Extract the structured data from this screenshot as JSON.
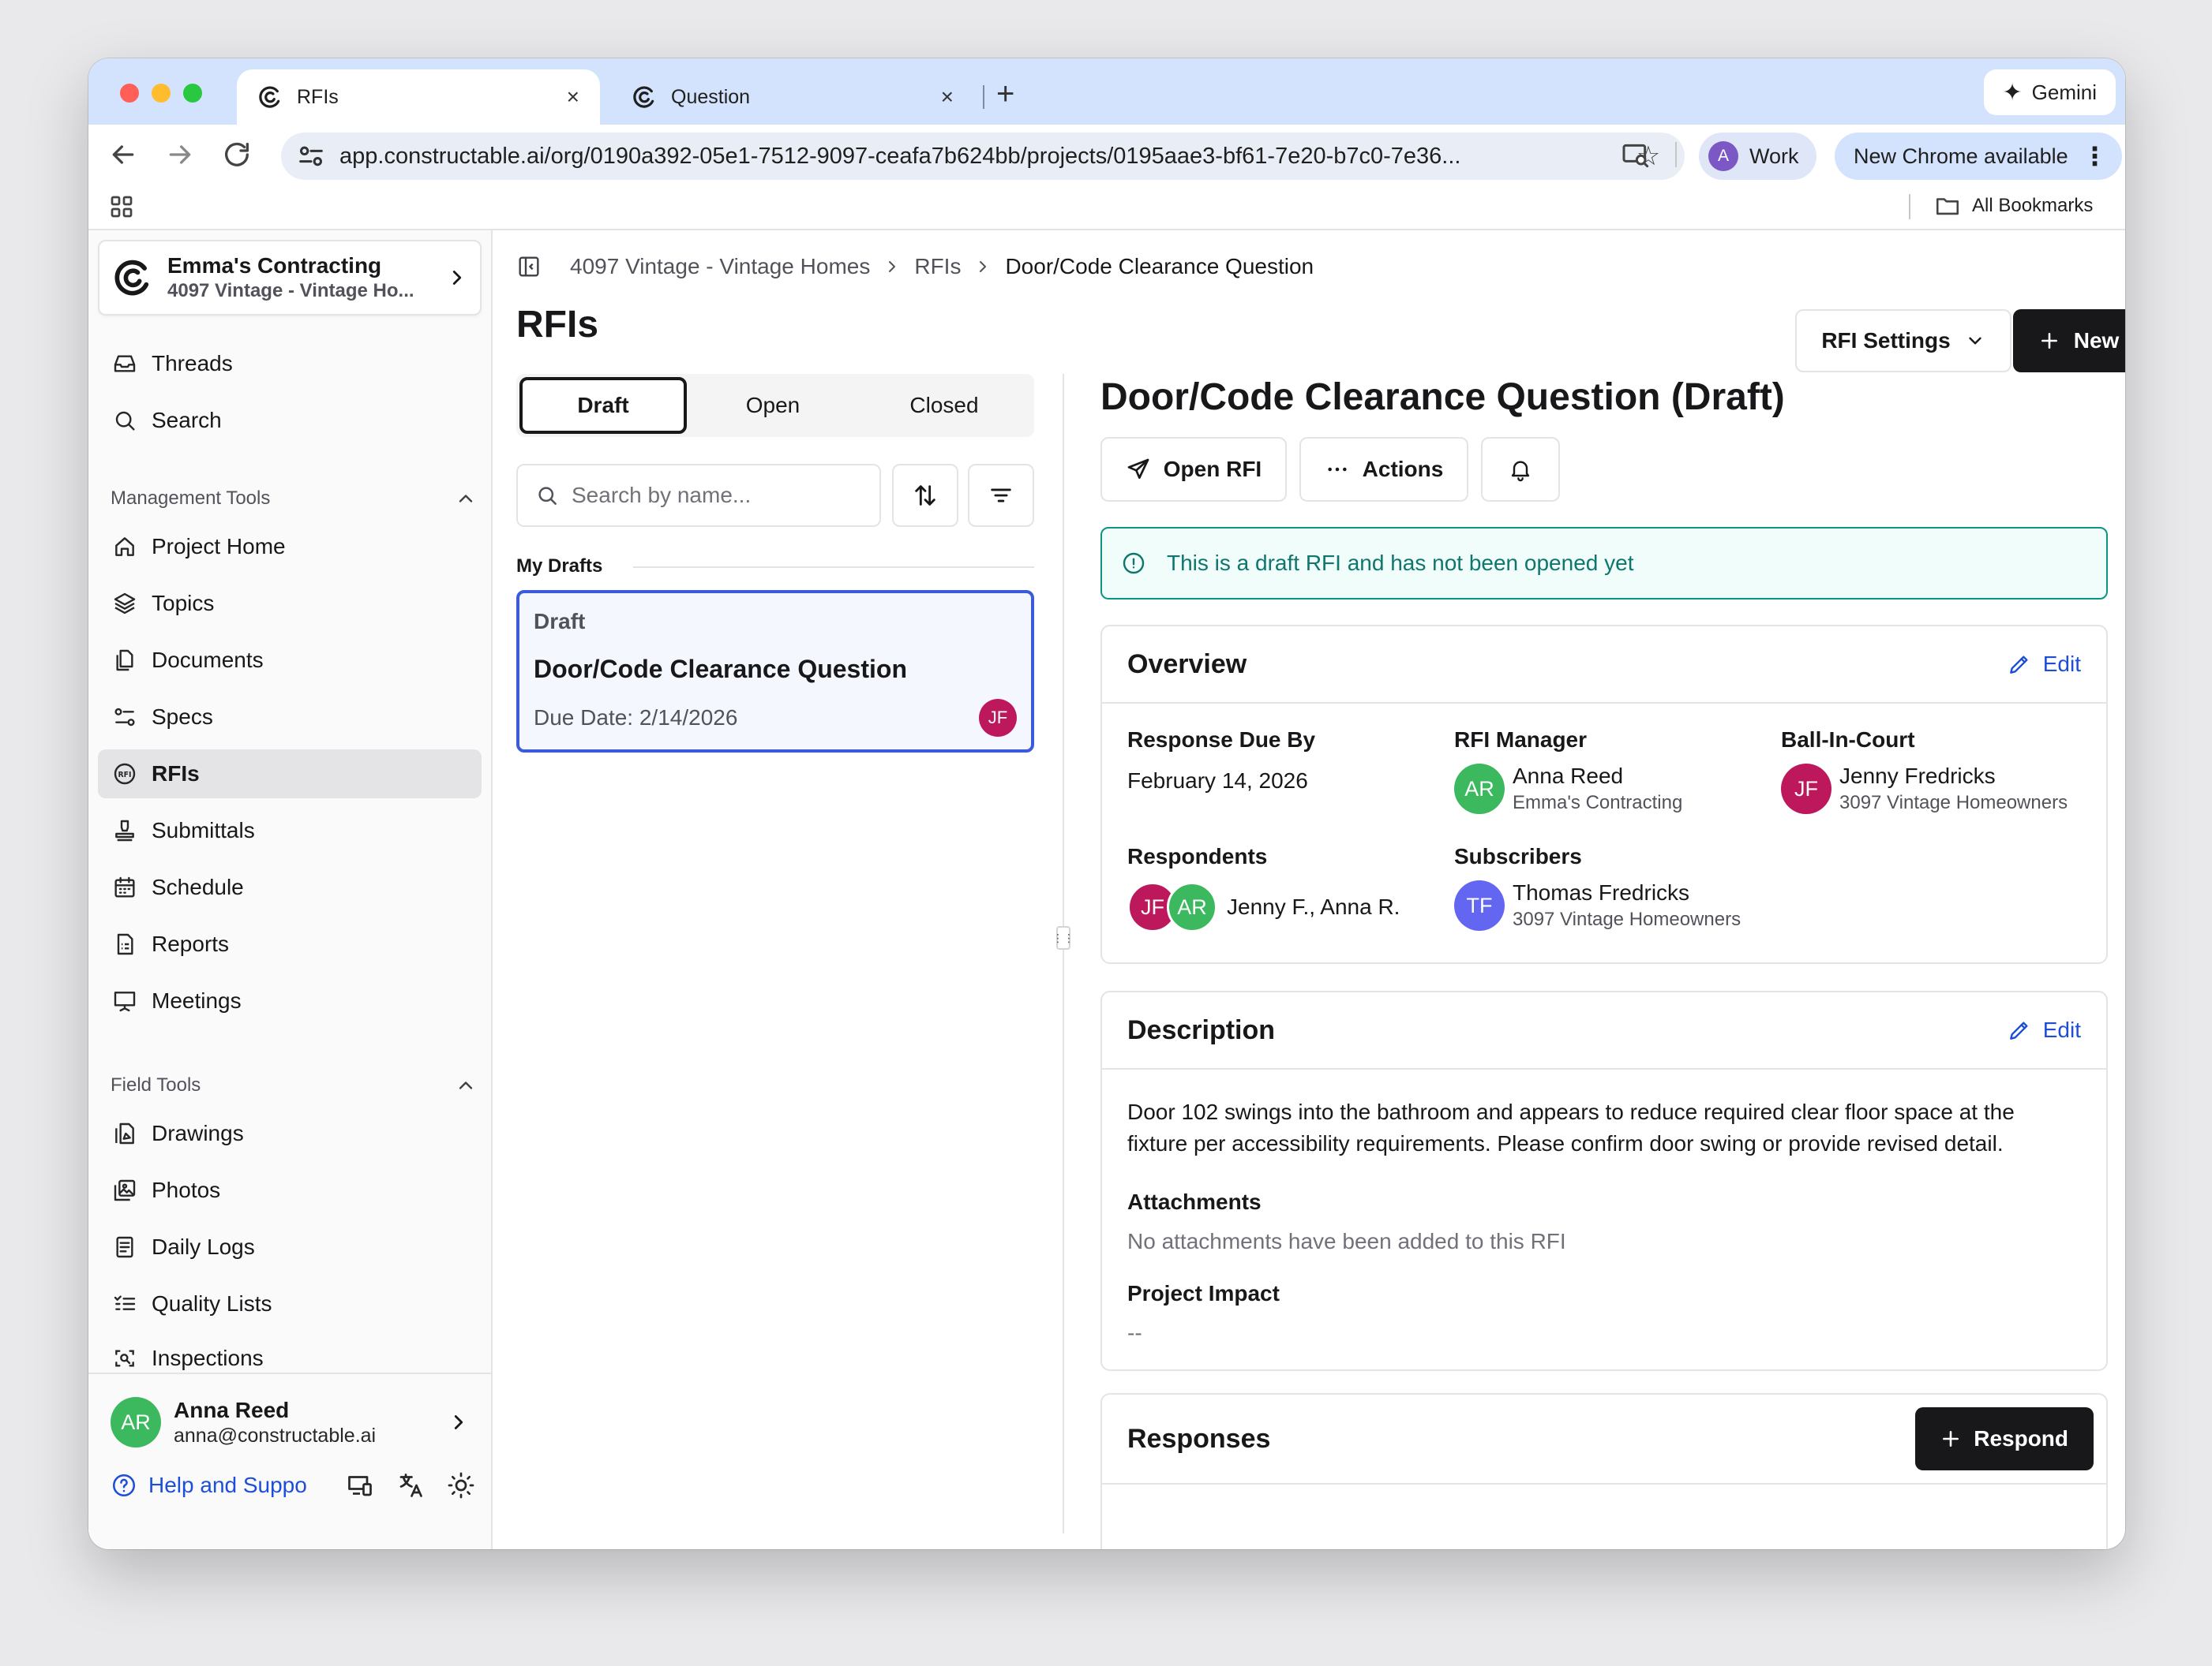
{
  "browser": {
    "tabs": [
      {
        "title": "RFIs",
        "close": "×"
      },
      {
        "title": "Question",
        "close": "×"
      }
    ],
    "new_tab": "+",
    "gemini": "Gemini",
    "url": "app.constructable.ai/org/0190a392-05e1-7512-9097-ceafa7b624bb/projects/0195aae3-bf61-7e20-b7c0-7e36...",
    "profile_initial": "A",
    "profile_name": "Work",
    "update_label": "New Chrome available",
    "all_bookmarks": "All Bookmarks"
  },
  "sidebar": {
    "org_name": "Emma's Contracting",
    "project_name": "4097 Vintage - Vintage Ho...",
    "top_items": [
      {
        "label": "Threads",
        "icon": "inbox-icon"
      },
      {
        "label": "Search",
        "icon": "search-icon"
      }
    ],
    "management_label": "Management Tools",
    "management_items": [
      {
        "label": "Project Home",
        "icon": "home-icon"
      },
      {
        "label": "Topics",
        "icon": "layers-icon"
      },
      {
        "label": "Documents",
        "icon": "documents-icon"
      },
      {
        "label": "Specs",
        "icon": "specs-icon"
      },
      {
        "label": "RFIs",
        "icon": "rfi-icon",
        "active": true
      },
      {
        "label": "Submittals",
        "icon": "stamp-icon"
      },
      {
        "label": "Schedule",
        "icon": "calendar-icon"
      },
      {
        "label": "Reports",
        "icon": "report-icon"
      },
      {
        "label": "Meetings",
        "icon": "presentation-icon"
      }
    ],
    "field_label": "Field Tools",
    "field_items": [
      {
        "label": "Drawings",
        "icon": "drawing-icon"
      },
      {
        "label": "Photos",
        "icon": "photos-icon"
      },
      {
        "label": "Daily Logs",
        "icon": "logs-icon"
      },
      {
        "label": "Quality Lists",
        "icon": "checklist-icon"
      },
      {
        "label": "Inspections",
        "icon": "scan-icon"
      }
    ],
    "user_initials": "AR",
    "user_name": "Anna Reed",
    "user_email": "anna@constructable.ai",
    "help_label": "Help and Suppo"
  },
  "breadcrumb": {
    "items": [
      "4097 Vintage - Vintage Homes",
      "RFIs"
    ],
    "current": "Door/Code Clearance Question"
  },
  "page_title": "RFIs",
  "header_buttons": {
    "settings": "RFI Settings",
    "new_rfi": "New RFI"
  },
  "list": {
    "tabs": [
      "Draft",
      "Open",
      "Closed"
    ],
    "active_tab": "Draft",
    "search_placeholder": "Search by name...",
    "section_label": "My Drafts",
    "cards": [
      {
        "status": "Draft",
        "title": "Door/Code Clearance Question",
        "due": "Due Date: 2/14/2026",
        "assignee_initials": "JF"
      }
    ]
  },
  "detail": {
    "title": "Door/Code Clearance Question (Draft)",
    "open_rfi": "Open RFI",
    "actions": "Actions",
    "alert": "This is a draft RFI and has not been opened yet",
    "overview": {
      "heading": "Overview",
      "edit": "Edit",
      "response_due_label": "Response Due By",
      "response_due_value": "February 14, 2026",
      "manager_label": "RFI Manager",
      "manager": {
        "initials": "AR",
        "name": "Anna Reed",
        "company": "Emma's Contracting"
      },
      "ball_label": "Ball-In-Court",
      "ball": {
        "initials": "JF",
        "name": "Jenny Fredricks",
        "company": "3097 Vintage Homeowners"
      },
      "respondents_label": "Respondents",
      "respondents": {
        "initials": [
          "JF",
          "AR"
        ],
        "names": "Jenny F., Anna R."
      },
      "subscribers_label": "Subscribers",
      "subscriber": {
        "initials": "TF",
        "name": "Thomas Fredricks",
        "company": "3097 Vintage Homeowners"
      }
    },
    "description": {
      "heading": "Description",
      "edit": "Edit",
      "text": "Door 102 swings into the bathroom and appears to reduce required clear floor space at the fixture per accessibility requirements. Please confirm door swing or provide revised detail.",
      "attachments_label": "Attachments",
      "attachments_value": "No attachments have been added to this RFI",
      "impact_label": "Project Impact",
      "impact_value": "--"
    },
    "responses": {
      "heading": "Responses",
      "respond": "Respond"
    }
  },
  "colors": {
    "accent_blue": "#1d4ed8",
    "card_border": "#3b5bdb",
    "alert_teal": "#0d9488",
    "avatar_green": "#3cb85f",
    "avatar_magenta": "#be185d",
    "avatar_indigo": "#6366f1",
    "dark_button": "#18181b"
  }
}
